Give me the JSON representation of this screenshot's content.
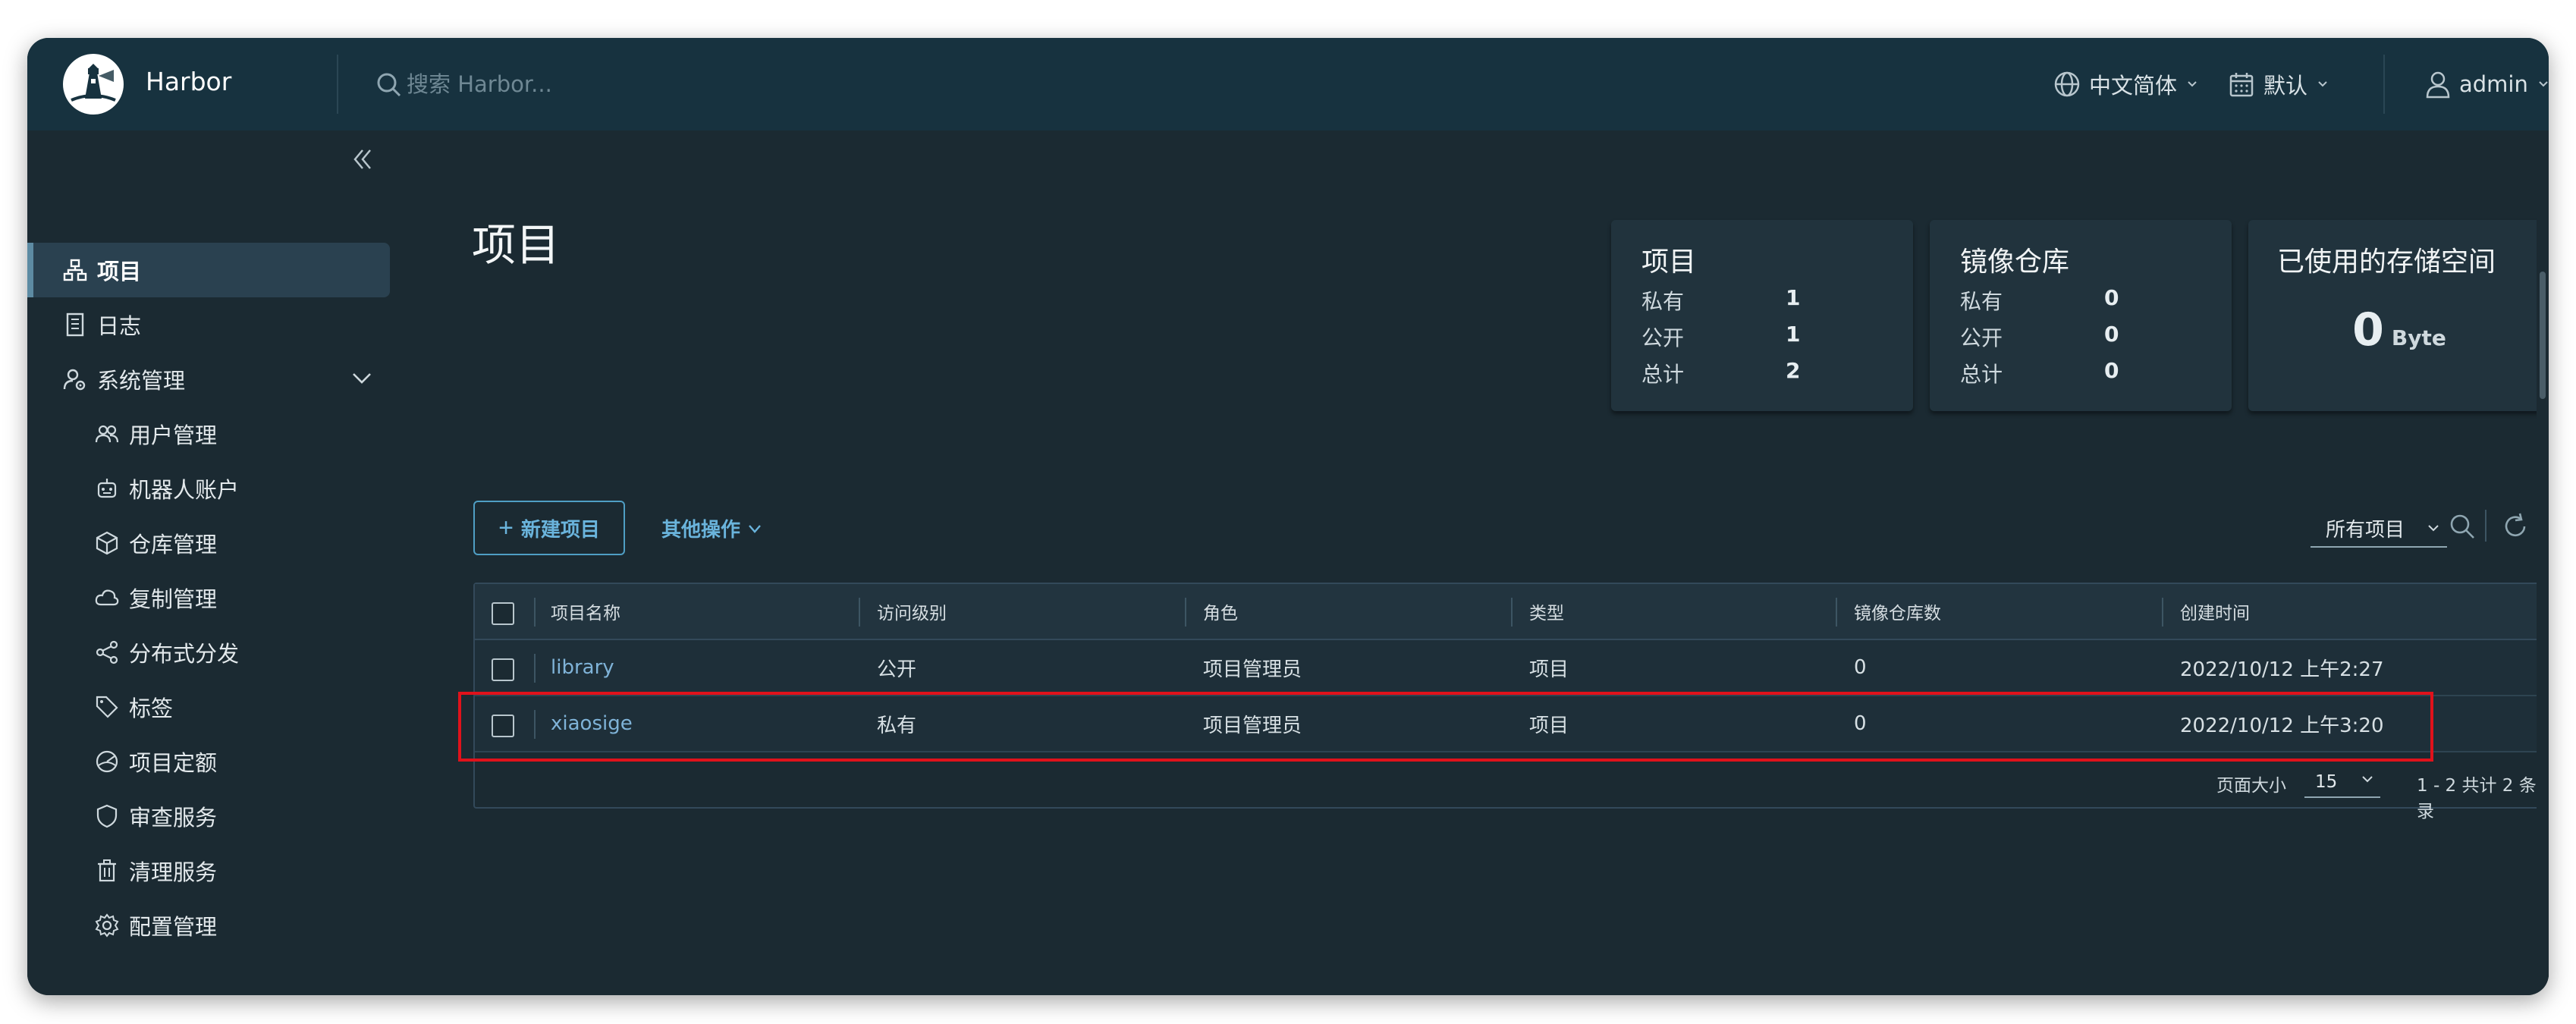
{
  "header": {
    "brand": "Harbor",
    "search_placeholder": "搜索 Harbor...",
    "language": "中文简体",
    "date_format": "默认",
    "user": "admin"
  },
  "sidebar": {
    "items": [
      {
        "label": "项目",
        "icon": "projects-icon",
        "active": true
      },
      {
        "label": "日志",
        "icon": "log-icon"
      },
      {
        "label": "系统管理",
        "icon": "admin-icon",
        "expanded": true
      }
    ],
    "children": [
      {
        "label": "用户管理",
        "icon": "users-icon"
      },
      {
        "label": "机器人账户",
        "icon": "robot-icon"
      },
      {
        "label": "仓库管理",
        "icon": "cube-icon"
      },
      {
        "label": "复制管理",
        "icon": "cloud-icon"
      },
      {
        "label": "分布式分发",
        "icon": "share-icon"
      },
      {
        "label": "标签",
        "icon": "tag-icon"
      },
      {
        "label": "项目定额",
        "icon": "quota-icon"
      },
      {
        "label": "审查服务",
        "icon": "shield-icon"
      },
      {
        "label": "清理服务",
        "icon": "trash-icon"
      },
      {
        "label": "配置管理",
        "icon": "gear-icon"
      }
    ]
  },
  "main": {
    "title": "项目",
    "cards": {
      "projects": {
        "title": "项目",
        "rows": [
          {
            "label": "私有",
            "value": "1"
          },
          {
            "label": "公开",
            "value": "1"
          },
          {
            "label": "总计",
            "value": "2"
          }
        ]
      },
      "repos": {
        "title": "镜像仓库",
        "rows": [
          {
            "label": "私有",
            "value": "0"
          },
          {
            "label": "公开",
            "value": "0"
          },
          {
            "label": "总计",
            "value": "0"
          }
        ]
      },
      "storage": {
        "title": "已使用的存储空间",
        "value": "0",
        "unit": "Byte"
      }
    },
    "new_project": "新建项目",
    "other_actions": "其他操作",
    "filter": "所有项目",
    "table": {
      "columns": [
        "项目名称",
        "访问级别",
        "角色",
        "类型",
        "镜像仓库数",
        "创建时间"
      ],
      "rows": [
        [
          "library",
          "公开",
          "项目管理员",
          "项目",
          "0",
          "2022/10/12 上午2:27"
        ],
        [
          "xiaosige",
          "私有",
          "项目管理员",
          "项目",
          "0",
          "2022/10/12 上午3:20"
        ]
      ],
      "page_size_label": "页面大小",
      "page_size": "15",
      "summary": "1 - 2 共计 2 条记录"
    }
  },
  "colors": {
    "accent": "#6ab4dc",
    "highlight": "#e0121b",
    "background": "#1b2a32",
    "header": "#17323f"
  }
}
